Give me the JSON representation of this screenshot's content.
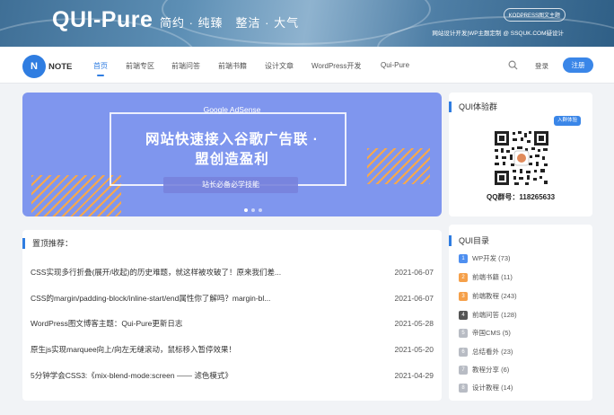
{
  "banner": {
    "title": "QUI-Pure",
    "slogan": "简约 · 纯臻　整洁 · 大气",
    "badge": "KODPRESS图文主题",
    "info": "网站设计开发|WP主题定制 @ SSQUK.COM疑设计"
  },
  "nav": {
    "logo_mark": "N",
    "logo_text": "NOTE",
    "items": [
      {
        "label": "首页"
      },
      {
        "label": "前端专区"
      },
      {
        "label": "前端问答"
      },
      {
        "label": "前端书籍"
      },
      {
        "label": "设计文章"
      },
      {
        "label": "WordPress开发"
      },
      {
        "label": "Qui-Pure"
      }
    ],
    "search_icon": "search-icon",
    "login": "登录",
    "register": "注册"
  },
  "slider": {
    "adsense": "Google AdSense",
    "headline_line1": "网站快速接入谷歌广告联 ·",
    "headline_line2": "盟创造盈利",
    "pill": "站长必备必学技能",
    "colors": {
      "background": "#7f96ee",
      "stripe": "#f7a84b"
    }
  },
  "pinned": {
    "heading": "置顶推荐：",
    "posts": [
      {
        "title": "CSS实现多行折叠(展开/收起)的历史难题，就这样被攻破了！原来我们差...",
        "date": "2021-06-07"
      },
      {
        "title": "CSS的margin/padding-block/inline-start/end属性你了解吗？margin-bl...",
        "date": "2021-06-07"
      },
      {
        "title": "WordPress图文博客主题：Qui-Pure更新日志",
        "date": "2021-05-28"
      },
      {
        "title": "原生js实现marquee向上/向左无缝滚动，鼠标移入暂停效果！",
        "date": "2021-05-20"
      },
      {
        "title": "5分钟学会CSS3:《mix-blend-mode:screen —— 滤色模式》",
        "date": "2021-04-29"
      }
    ]
  },
  "qq_group": {
    "heading": "QUI体验群",
    "join": "入群体验",
    "number": "QQ群号：118265633"
  },
  "categories": {
    "heading": "QUI目录",
    "items": [
      {
        "num": "1",
        "label": "WP开发 (73)",
        "color": "#4e8ff0"
      },
      {
        "num": "2",
        "label": "前端书籍 (11)",
        "color": "#f5a04a"
      },
      {
        "num": "3",
        "label": "前端教程 (243)",
        "color": "#f5a04a"
      },
      {
        "num": "4",
        "label": "前端问答 (128)",
        "color": "#555555"
      },
      {
        "num": "5",
        "label": "帝国CMS (5)",
        "color": "#b8bcc4"
      },
      {
        "num": "6",
        "label": "总结看外 (23)",
        "color": "#b8bcc4"
      },
      {
        "num": "7",
        "label": "教程分享 (6)",
        "color": "#b8bcc4"
      },
      {
        "num": "8",
        "label": "设计教程 (14)",
        "color": "#b8bcc4"
      }
    ]
  }
}
